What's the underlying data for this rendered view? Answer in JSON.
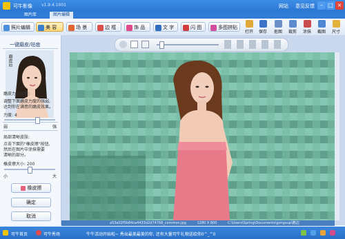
{
  "app": {
    "title": "可牛影像",
    "version": "v1.9.4.1001",
    "links": [
      "网站",
      "意见反馈"
    ]
  },
  "tabs": [
    {
      "label": "图片库"
    },
    {
      "label": "图片编辑"
    }
  ],
  "toolbar": {
    "buttons": [
      "照片编辑",
      "美 容",
      "场 景",
      "边 框",
      "饰 品",
      "文 字",
      "闪 图",
      "多图拼贴"
    ],
    "right_tools": [
      "打开",
      "保存",
      "抠图",
      "裁剪",
      "涂抹",
      "截图",
      "尺寸"
    ]
  },
  "left_panel": {
    "heading": "一键磨皮/祛痘",
    "portrait_label": "磨皮后",
    "sec1_title": "磨皮力度调整:",
    "sec1_desc": [
      "调整下面磨皮力度的强弱,",
      "达到你在满意的磨皮效果。"
    ],
    "strength_label": "力度: 4",
    "strength_value": 4,
    "scale_low": "弱",
    "scale_high": "强",
    "sec2_title": "局部清晰皮肤:",
    "sec2_desc": [
      "点击下面的\"橡皮擦\"按钮,",
      "然后在图片中涂抹需要",
      "清晰的部分。"
    ],
    "eraser_size_label": "橡皮擦大小: 200",
    "eraser_size_value": 200,
    "size_small": "小",
    "size_large": "大",
    "eraser_button": "橡皮擦",
    "ok_button": "确定",
    "cancel_button": "取消"
  },
  "image_info": {
    "filename": "a53a02f5b84ca4433d2d74768_common.jpg",
    "dimensions": "1280 X 800",
    "path": "C:\\Users\\Spring\\Documents\\gongsup\\鹏边"
  },
  "status": {
    "left_items": [
      "可牛首页",
      "可牛秀场"
    ],
    "message": "牛牛活动开始啦~ 秀出最美最美的你, 还有大量可牛礼物送给你0^_^0"
  },
  "colors": {
    "titlebar": "#2f7bd6",
    "panel_bg": "#f4f8fd",
    "selected_tab": "#ffd77a",
    "dress": "#e87a8a"
  }
}
